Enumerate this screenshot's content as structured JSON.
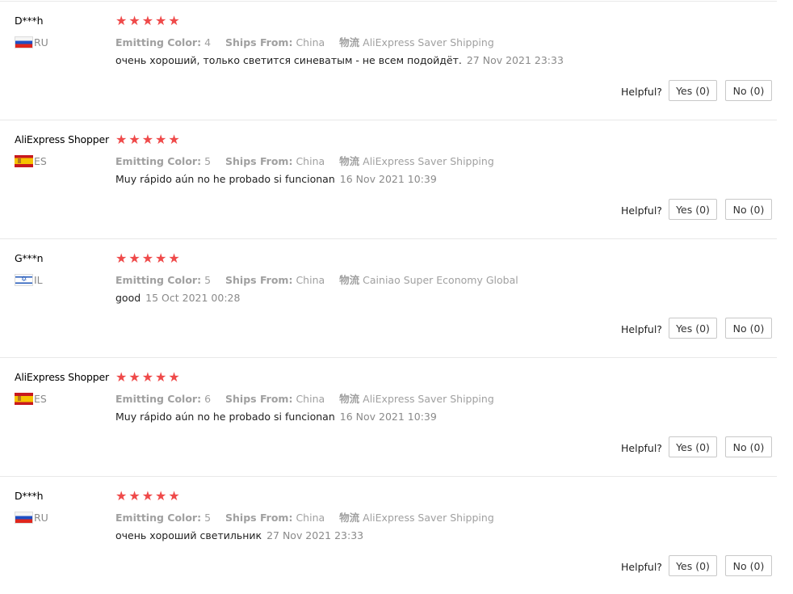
{
  "labels": {
    "emitting_color": "Emitting Color:",
    "ships_from": "Ships From:",
    "logistics": "物流",
    "helpful": "Helpful?"
  },
  "colors": {
    "star": "#ef4a4a",
    "divider": "#e8e8e8",
    "muted_text": "#a0a0a0"
  },
  "reviews": [
    {
      "user": "D***h",
      "country": "RU",
      "flag": "ru-flag",
      "rating": 5,
      "emitting_color": "4",
      "ships_from": "China",
      "logistics": "AliExpress Saver Shipping",
      "text": "очень хороший, только светится синеватым - не всем подойдёт.",
      "date": "27 Nov 2021 23:33",
      "yes": "Yes (0)",
      "no": "No (0)"
    },
    {
      "user": "AliExpress Shopper",
      "country": "ES",
      "flag": "es-flag",
      "rating": 5,
      "emitting_color": "5",
      "ships_from": "China",
      "logistics": "AliExpress Saver Shipping",
      "text": "Muy rápido aún no he probado si funcionan",
      "date": "16 Nov 2021 10:39",
      "yes": "Yes (0)",
      "no": "No (0)"
    },
    {
      "user": "G***n",
      "country": "IL",
      "flag": "il-flag",
      "rating": 5,
      "emitting_color": "5",
      "ships_from": "China",
      "logistics": "Cainiao Super Economy Global",
      "text": "good",
      "date": "15 Oct 2021 00:28",
      "yes": "Yes (0)",
      "no": "No (0)"
    },
    {
      "user": "AliExpress Shopper",
      "country": "ES",
      "flag": "es-flag",
      "rating": 5,
      "emitting_color": "6",
      "ships_from": "China",
      "logistics": "AliExpress Saver Shipping",
      "text": "Muy rápido aún no he probado si funcionan",
      "date": "16 Nov 2021 10:39",
      "yes": "Yes (0)",
      "no": "No (0)"
    },
    {
      "user": "D***h",
      "country": "RU",
      "flag": "ru-flag",
      "rating": 5,
      "emitting_color": "5",
      "ships_from": "China",
      "logistics": "AliExpress Saver Shipping",
      "text": "очень хороший светильник",
      "date": "27 Nov 2021 23:33",
      "yes": "Yes (0)",
      "no": "No (0)"
    }
  ]
}
